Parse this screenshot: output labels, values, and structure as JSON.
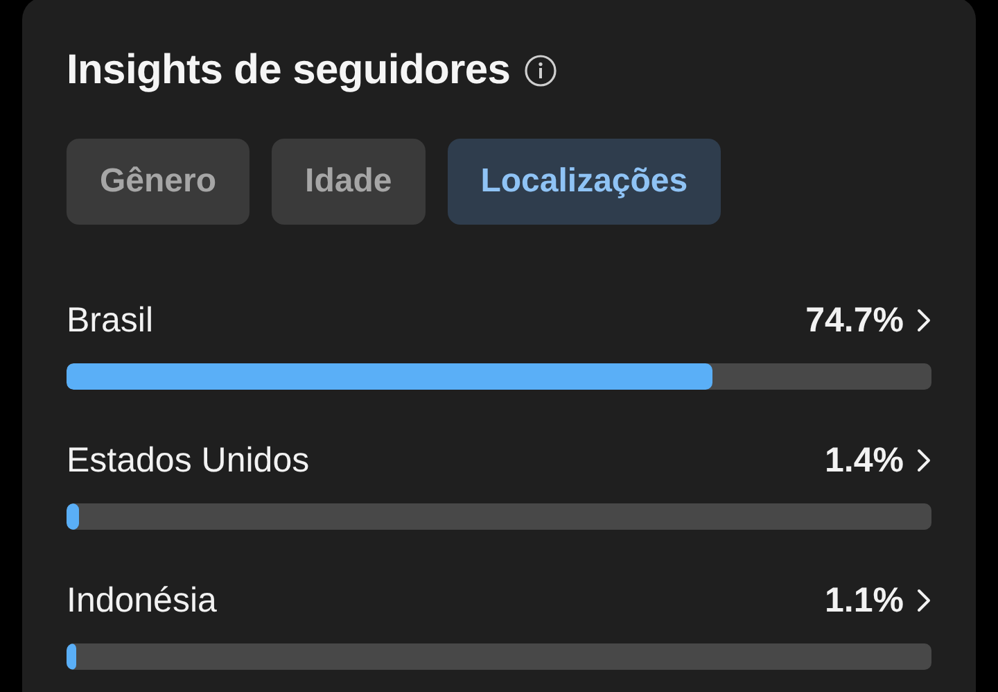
{
  "card": {
    "title": "Insights de seguidores",
    "tabs": [
      {
        "label": "Gênero",
        "selected": false
      },
      {
        "label": "Idade",
        "selected": false
      },
      {
        "label": "Localizações",
        "selected": true
      }
    ],
    "locations": [
      {
        "name": "Brasil",
        "reading": "74.7%",
        "level": 0.747
      },
      {
        "name": "Estados Unidos",
        "reading": "1.4%",
        "level": 0.014
      },
      {
        "name": "Indonésia",
        "reading": "1.1%",
        "level": 0.011
      }
    ]
  }
}
